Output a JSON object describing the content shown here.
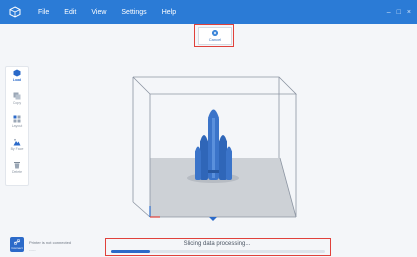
{
  "menu": {
    "items": [
      "File",
      "Edit",
      "View",
      "Settings",
      "Help"
    ]
  },
  "window_controls": {
    "minimize": "–",
    "restore": "□",
    "close": "×"
  },
  "toolbar": {
    "cancel_label": "Cancel"
  },
  "sidebar": {
    "tools": [
      {
        "label": "Load",
        "icon": "cube-icon",
        "active": true
      },
      {
        "label": "Copy",
        "icon": "copy-icon",
        "active": false
      },
      {
        "label": "Layout",
        "icon": "grid-icon",
        "active": false
      },
      {
        "label": "By Face",
        "icon": "mountain-icon",
        "active": false
      },
      {
        "label": "Delete",
        "icon": "trash-icon",
        "active": false
      }
    ]
  },
  "printer": {
    "button_label": "Connect",
    "status": "Printer is not connected",
    "sub": "-----"
  },
  "slicing": {
    "message": "Slicing data processing...",
    "progress": 0.18
  },
  "colors": {
    "accent": "#2b7bd6",
    "model": "#3b74c9",
    "callout": "#e0413b"
  }
}
